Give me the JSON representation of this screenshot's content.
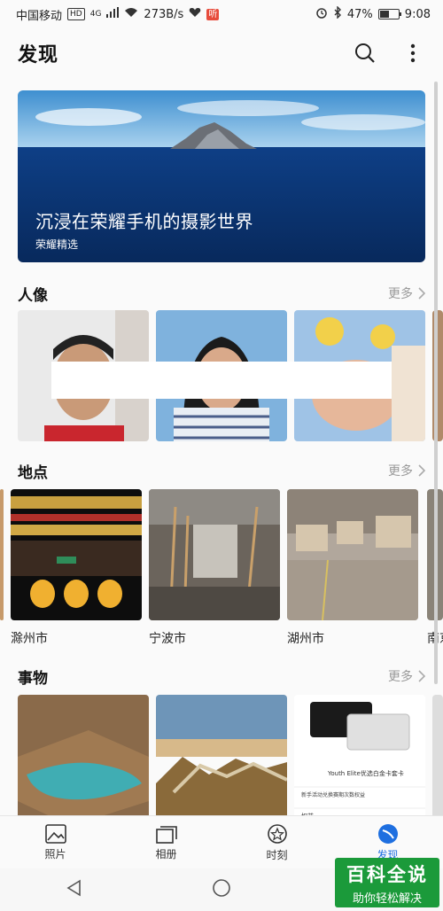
{
  "status_bar": {
    "carrier": "中国移动",
    "hd": "HD",
    "network": "4G",
    "speed": "273B/s",
    "app_badge": "听",
    "battery": "47%",
    "time": "9:08"
  },
  "header": {
    "title": "发现"
  },
  "hero": {
    "title": "沉浸在荣耀手机的摄影世界",
    "subtitle": "荣耀精选"
  },
  "sections": {
    "people": {
      "title": "人像",
      "more": "更多"
    },
    "places": {
      "title": "地点",
      "more": "更多",
      "items": [
        "滁州市",
        "宁波市",
        "湖州市",
        "南京"
      ]
    },
    "things": {
      "title": "事物",
      "more": "更多",
      "card_text": {
        "title": "Youth Elite优选白金卡套卡",
        "line": "新手活动兑换赛期次数权益",
        "label": "权益"
      }
    }
  },
  "bottom_nav": {
    "items": [
      {
        "label": "照片"
      },
      {
        "label": "相册"
      },
      {
        "label": "时刻"
      },
      {
        "label": "发现"
      }
    ],
    "active_index": 3
  },
  "watermark": {
    "main": "百科全说",
    "sub": "助你轻松解决"
  },
  "colors": {
    "accent": "#1e6fe0",
    "watermark_bg": "#1b9a3a"
  }
}
